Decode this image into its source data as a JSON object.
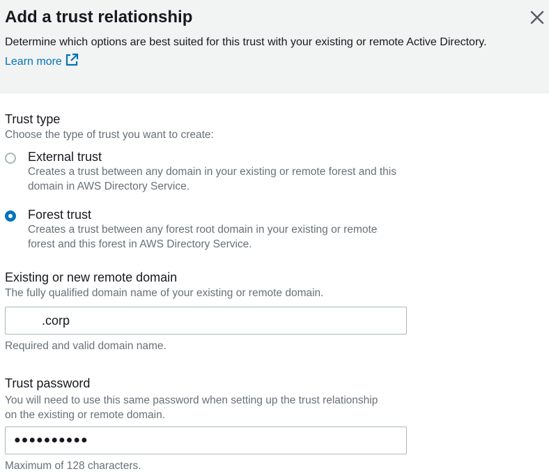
{
  "modal": {
    "title": "Add a trust relationship",
    "description": "Determine which options are best suited for this trust with your existing or remote Active Directory.",
    "learn_more": "Learn more",
    "close_icon": "close-icon",
    "external_link_icon": "external-link-icon"
  },
  "trust_type": {
    "label": "Trust type",
    "description": "Choose the type of trust you want to create:",
    "selected": "Forest trust",
    "options": [
      {
        "label": "External trust",
        "description": "Creates a trust between any domain in your existing or remote forest and this domain in AWS Directory Service."
      },
      {
        "label": "Forest trust",
        "description": "Creates a trust between any forest root domain in your existing or remote forest and this forest in AWS Directory Service."
      }
    ]
  },
  "remote_domain": {
    "label": "Existing or new remote domain",
    "description": "The fully qualified domain name of your existing or remote domain.",
    "value": "        .corp",
    "hint": "Required and valid domain name."
  },
  "trust_password": {
    "label": "Trust password",
    "description": "You will need to use this same password when setting up the trust relationship on the existing or remote domain.",
    "value": "●●●●●●●●●●",
    "hint": "Maximum of 128 characters."
  },
  "colors": {
    "accent": "#0073bb",
    "header_bg": "#f2f3f3",
    "muted_text": "#687078",
    "border": "#aab7b8"
  }
}
